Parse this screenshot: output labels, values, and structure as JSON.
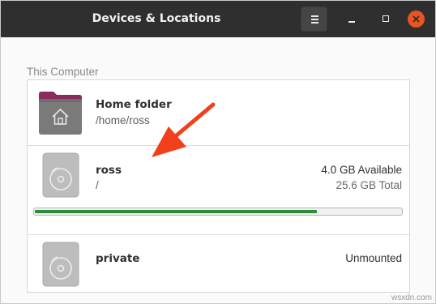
{
  "window": {
    "title": "Devices & Locations"
  },
  "section": {
    "label": "This Computer"
  },
  "locations": [
    {
      "name": "Home folder",
      "path": "/home/ross"
    },
    {
      "name": "ross",
      "path": "/",
      "available": "4.0 GB Available",
      "total": "25.6 GB Total",
      "usage_fraction": 0.77
    },
    {
      "name": "private",
      "status": "Unmounted"
    }
  ],
  "colors": {
    "accent_close": "#e95420",
    "usage_bar": "#2e8b3a",
    "folder": "#8b2b5b",
    "annotation_arrow": "#f2401c"
  },
  "watermark": "wsxdn.com"
}
